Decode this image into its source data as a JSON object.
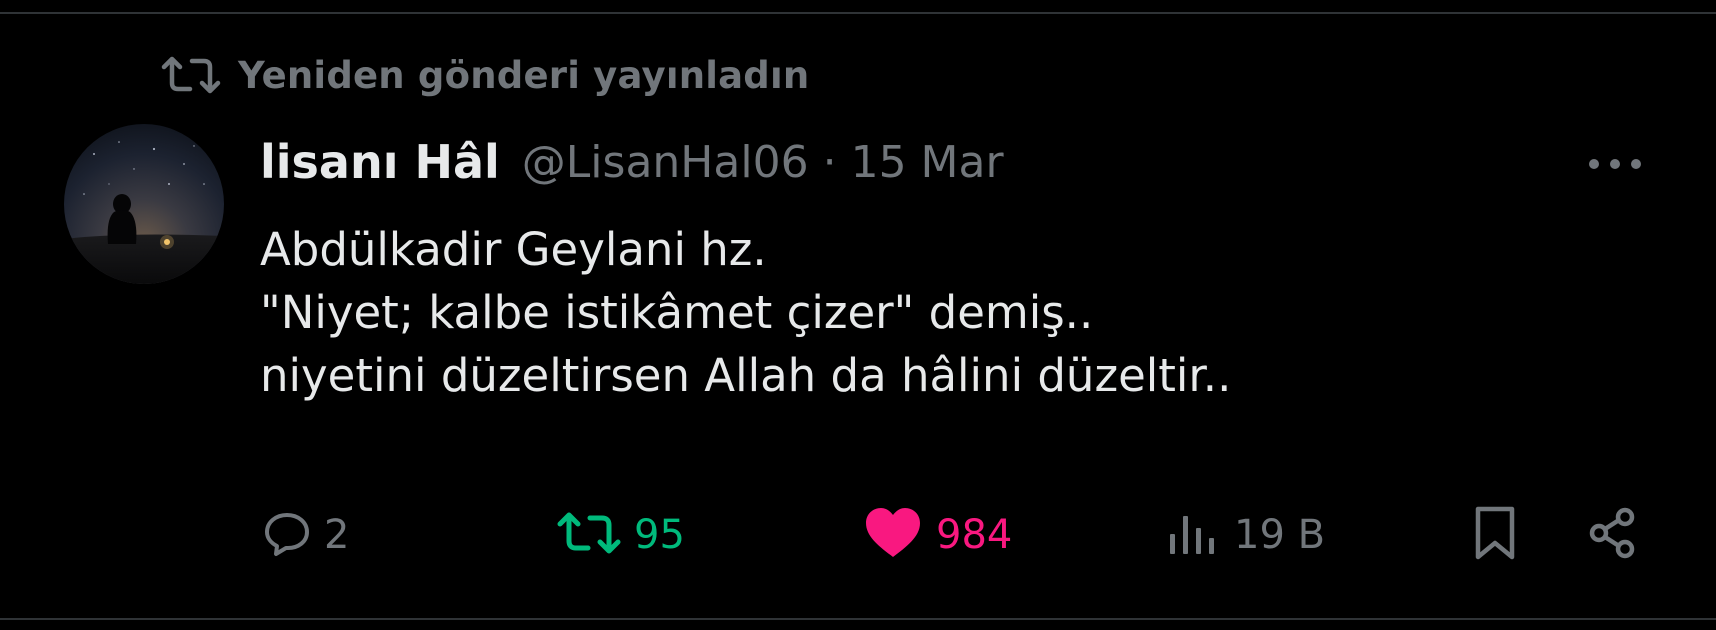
{
  "repost_banner": {
    "label": "Yeniden gönderi yayınladın",
    "icon": "retweet-icon"
  },
  "author": {
    "display_name": "lisanı Hâl",
    "handle": "@LisanHal06",
    "separator": "·",
    "date": "15 Mar",
    "avatar_icon": "avatar-night-sky"
  },
  "tweet": {
    "lines": [
      "Abdülkadir Geylani hz.",
      "\"Niyet; kalbe istikâmet çizer\" demiş..",
      "niyetini düzeltirsen Allah da hâlini düzeltir.."
    ]
  },
  "actions": {
    "reply": {
      "count": "2",
      "icon": "reply-icon"
    },
    "retweet": {
      "count": "95",
      "icon": "retweet-icon",
      "active": true
    },
    "like": {
      "count": "984",
      "icon": "heart-icon",
      "active": true
    },
    "views": {
      "count": "19 B",
      "icon": "views-icon"
    },
    "bookmark": {
      "icon": "bookmark-icon"
    },
    "share": {
      "icon": "share-icon"
    }
  },
  "colors": {
    "background": "#000000",
    "text_primary": "#e7e9ea",
    "text_secondary": "#71767b",
    "retweet_green": "#00ba7c",
    "like_pink": "#f91880",
    "divider": "#2f3336"
  }
}
